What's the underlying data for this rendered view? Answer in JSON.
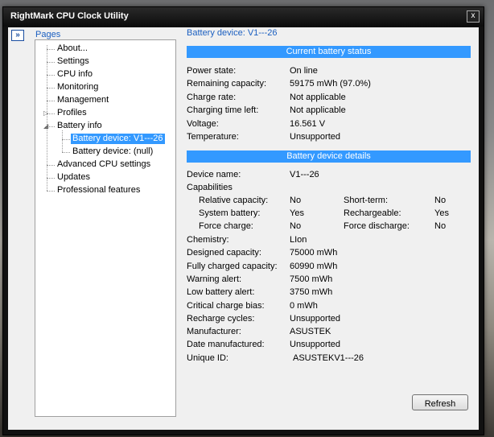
{
  "window": {
    "title": "RightMark CPU Clock Utility",
    "close_glyph": "x"
  },
  "pages_label": "Pages",
  "collapse_glyph": "»",
  "tree": [
    {
      "label": "About...",
      "level": 0
    },
    {
      "label": "Settings",
      "level": 0
    },
    {
      "label": "CPU info",
      "level": 0
    },
    {
      "label": "Monitoring",
      "level": 0
    },
    {
      "label": "Management",
      "level": 0
    },
    {
      "label": "Profiles",
      "level": 0,
      "expander": "▷"
    },
    {
      "label": "Battery info",
      "level": 0,
      "expander": "◢"
    },
    {
      "label": "Battery device: V1---26",
      "level": 1,
      "selected": true
    },
    {
      "label": "Battery device: (null)",
      "level": 1
    },
    {
      "label": "Advanced CPU settings",
      "level": 0
    },
    {
      "label": "Updates",
      "level": 0
    },
    {
      "label": "Professional features",
      "level": 0
    }
  ],
  "header": "Battery device: V1---26",
  "status": {
    "title": "Current battery status",
    "rows": [
      {
        "label": "Power state:",
        "value": "On line"
      },
      {
        "label": "Remaining capacity:",
        "value": "59175 mWh (97.0%)"
      },
      {
        "label": "Charge rate:",
        "value": "Not applicable"
      },
      {
        "label": "Charging time left:",
        "value": "Not applicable"
      },
      {
        "label": "Voltage:",
        "value": "16.561 V"
      },
      {
        "label": "Temperature:",
        "value": "Unsupported"
      }
    ]
  },
  "details": {
    "title": "Battery device details",
    "device_name": {
      "label": "Device name:",
      "value": "V1---26"
    },
    "capabilities_label": "Capabilities",
    "capabilities": [
      {
        "label": "Relative capacity:",
        "value": "No",
        "label2": "Short-term:",
        "value2": "No"
      },
      {
        "label": "System battery:",
        "value": "Yes",
        "label2": "Rechargeable:",
        "value2": "Yes"
      },
      {
        "label": "Force charge:",
        "value": "No",
        "label2": "Force discharge:",
        "value2": "No"
      }
    ],
    "rows": [
      {
        "label": "Chemistry:",
        "value": "LIon"
      },
      {
        "label": "Designed capacity:",
        "value": "75000 mWh"
      },
      {
        "label": "Fully charged capacity:",
        "value": "60990 mWh"
      },
      {
        "label": "Warning alert:",
        "value": "7500 mWh"
      },
      {
        "label": "Low battery alert:",
        "value": "3750 mWh"
      },
      {
        "label": "Critical charge bias:",
        "value": "0 mWh"
      },
      {
        "label": "Recharge cycles:",
        "value": "Unsupported"
      },
      {
        "label": "Manufacturer:",
        "value": "ASUSTEK"
      },
      {
        "label": "Date manufactured:",
        "value": "Unsupported"
      },
      {
        "label": "Unique ID:",
        "value": "ASUSTEKV1---26"
      }
    ]
  },
  "refresh_label": "Refresh"
}
